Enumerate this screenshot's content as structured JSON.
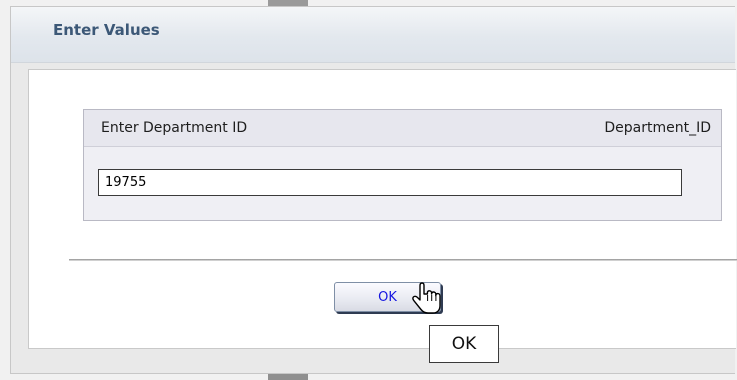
{
  "dialog": {
    "title": "Enter Values"
  },
  "prompt": {
    "label": "Enter Department ID",
    "parameter_name": "Department_ID",
    "value": "19755"
  },
  "ok_button": {
    "label": "OK"
  },
  "tooltip": {
    "text": "OK"
  },
  "cursor": {
    "icon": "hand-pointer-icon"
  },
  "colors": {
    "title_text": "#3c5877",
    "button_text": "#1515e0",
    "panel_bg": "#efeff4"
  }
}
